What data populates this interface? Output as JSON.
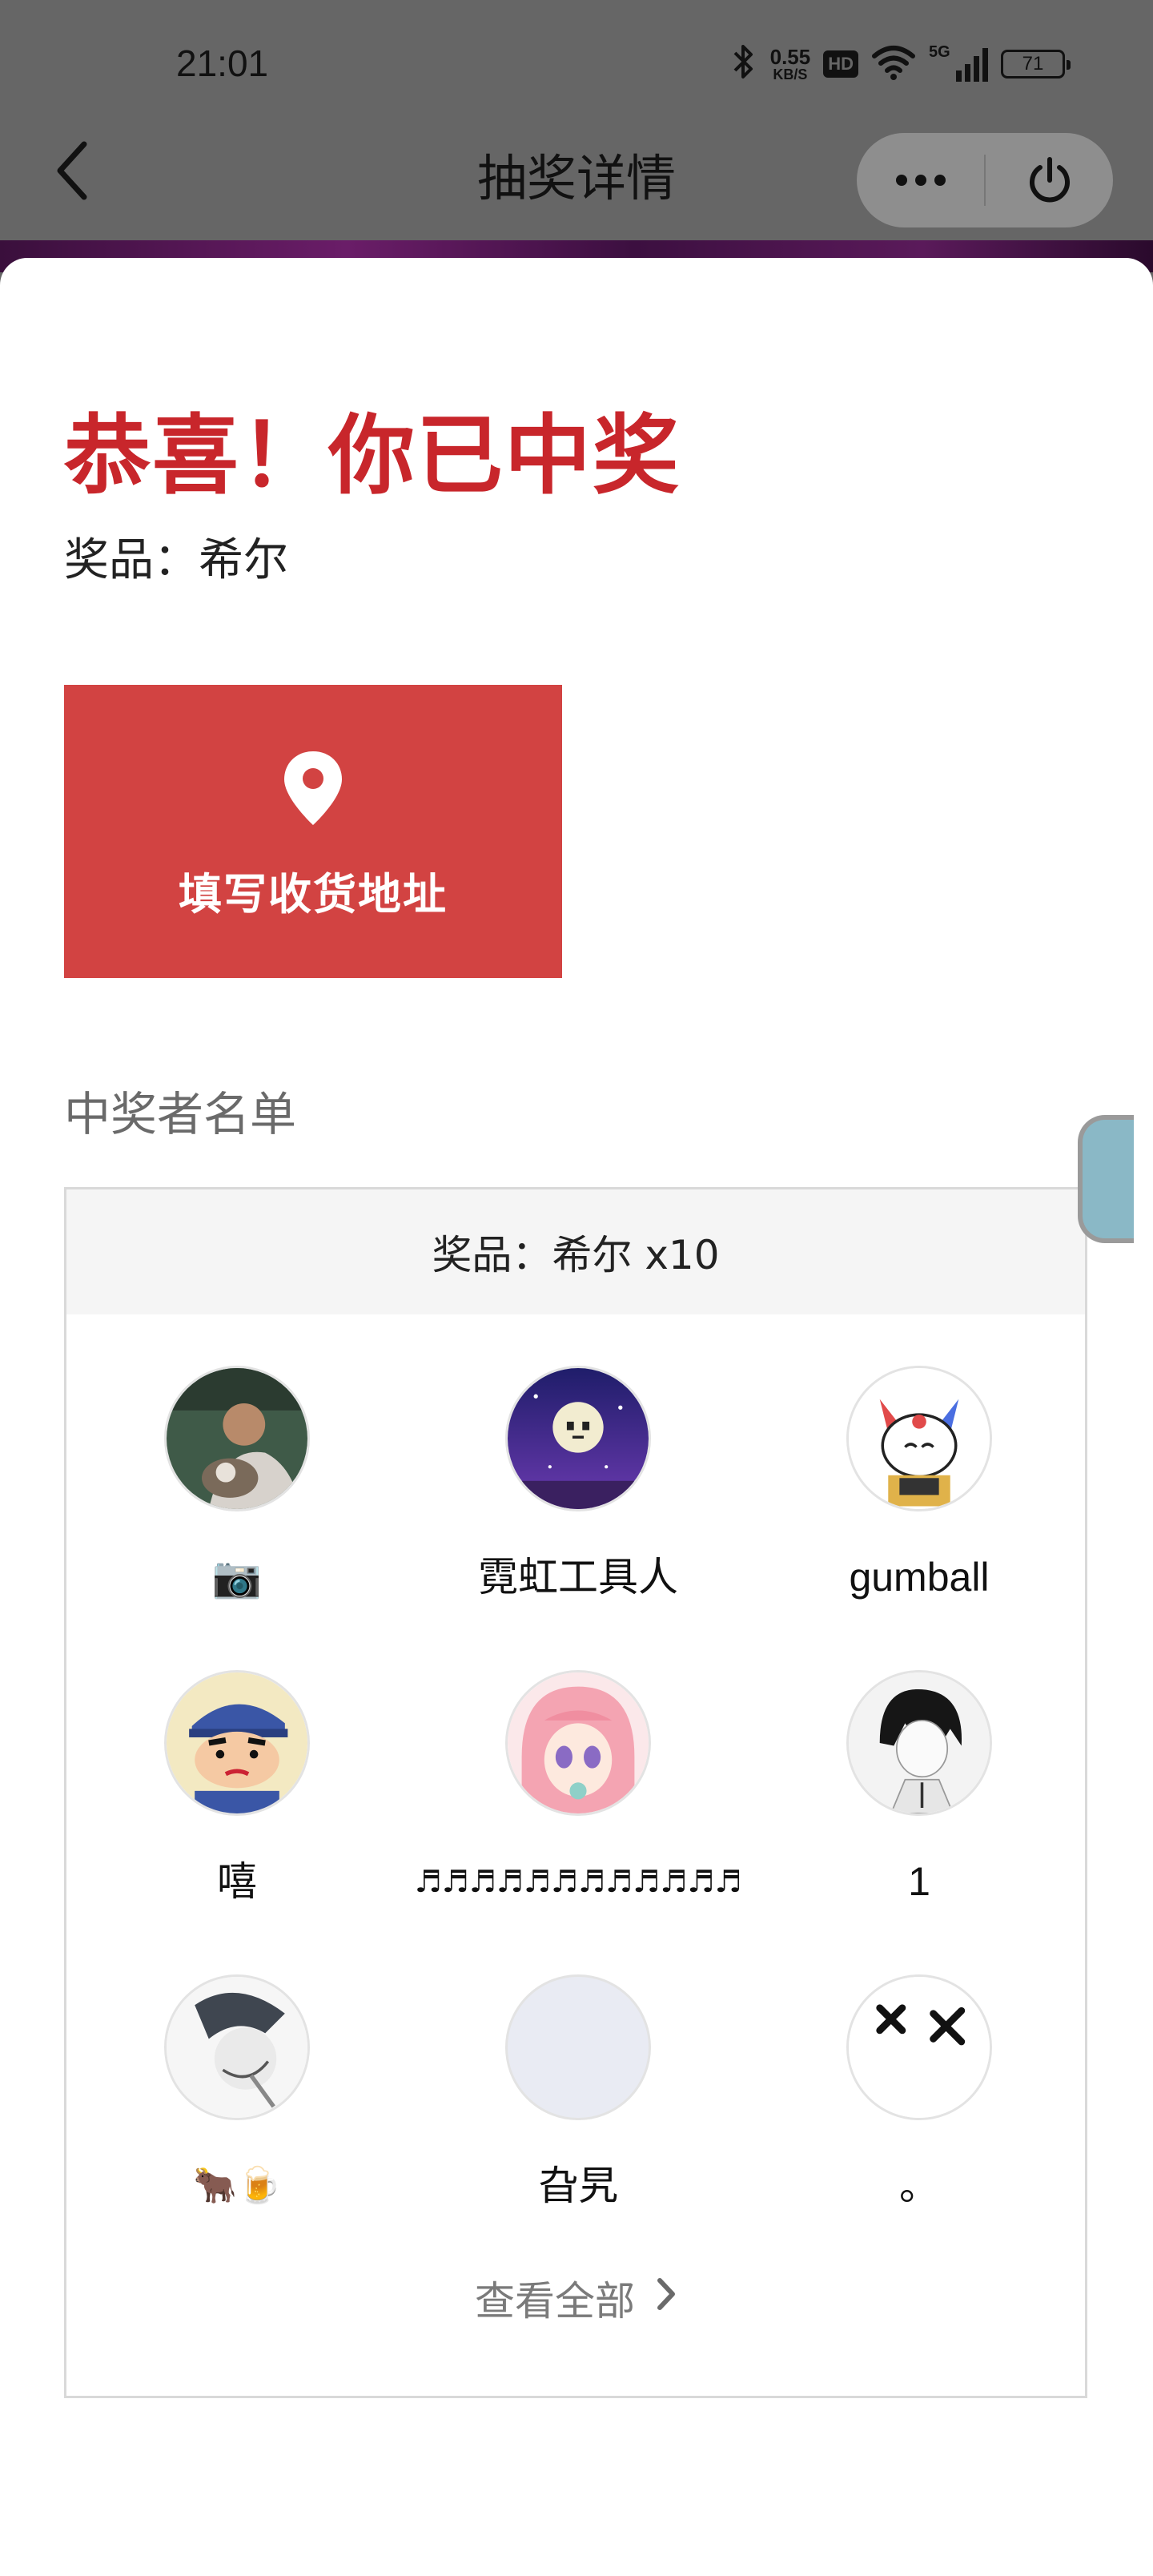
{
  "status_bar": {
    "time": "21:01",
    "net_speed_value": "0.55",
    "net_speed_unit": "KB/S",
    "hd": "HD",
    "signal_gen": "5G",
    "battery": "71",
    "icons": [
      "bluetooth-icon",
      "wifi-icon",
      "signal-icon",
      "battery-icon"
    ]
  },
  "nav": {
    "title": "抽奖详情",
    "icons": [
      "back-arrow-icon",
      "more-dots-icon",
      "power-icon"
    ]
  },
  "result": {
    "headline": "恭喜！你已中奖",
    "prize": "奖品：希尔"
  },
  "address_button": {
    "label": "填写收货地址",
    "icon": "location-pin-icon"
  },
  "winners": {
    "heading": "中奖者名单",
    "box_title": "奖品：希尔 x10",
    "list": [
      {
        "name": "📷",
        "avatar": "photo-avatar"
      },
      {
        "name": "霓虹工具人",
        "avatar": "moon-night-avatar"
      },
      {
        "name": "gumball",
        "avatar": "fox-cartoon-avatar"
      },
      {
        "name": "嘻",
        "avatar": "crayon-shin-avatar"
      },
      {
        "name": "♬♬♬♬♬♬♬♬♬♬♬♬",
        "avatar": "anime-girl-avatar"
      },
      {
        "name": "1",
        "avatar": "manga-boy-avatar"
      },
      {
        "name": "🐂🍺",
        "avatar": "sketch-avatar"
      },
      {
        "name": "旮旯",
        "avatar": "blank-avatar"
      },
      {
        "name": "。",
        "avatar": "x-eyes-avatar"
      }
    ],
    "view_all": "查看全部"
  },
  "colors": {
    "accent_red": "#c8262b",
    "button_red": "#d24342",
    "overlay_gray": "#666666"
  }
}
